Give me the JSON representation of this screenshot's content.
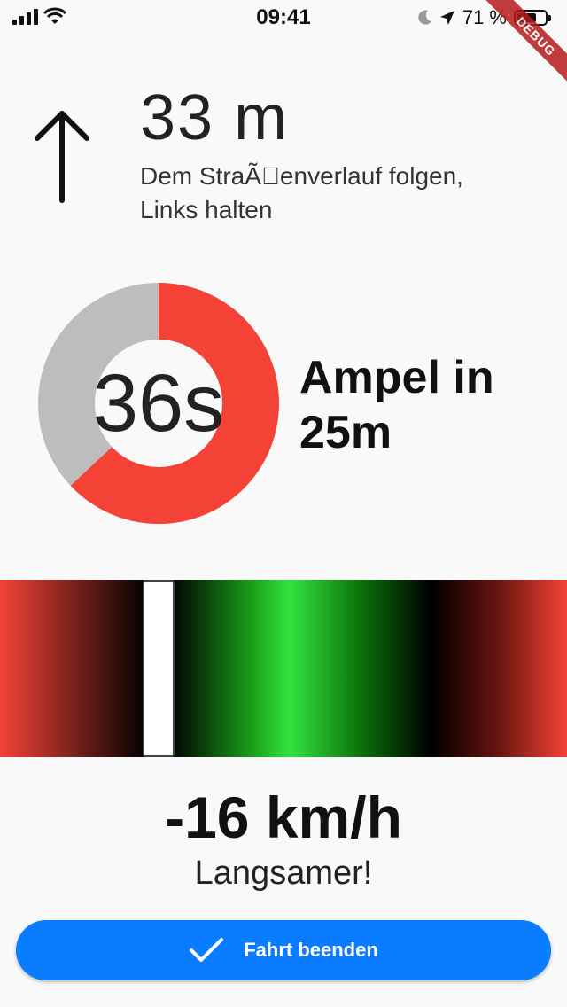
{
  "status_bar": {
    "time": "09:41",
    "battery_text": "71 %",
    "battery_level": 0.71,
    "icons": [
      "signal-icon",
      "wifi-icon",
      "moon-icon",
      "location-arrow-icon",
      "battery-icon"
    ]
  },
  "debug_banner": "DEBUG",
  "navigation": {
    "direction_icon": "arrow-up-icon",
    "distance": "33 m",
    "instruction": "Dem StraÃ\u0000enverlauf folgen, Links halten"
  },
  "traffic_light": {
    "countdown": "36s",
    "remaining_fraction": 0.63,
    "colors": {
      "remaining": "#f44336",
      "elapsed": "#bdbdbd"
    },
    "label": "Ampel in 25m"
  },
  "speed": {
    "marker_position": 0.28,
    "value": "-16 km/h",
    "hint": "Langsamer!"
  },
  "end_button": {
    "icon": "check-icon",
    "label": "Fahrt beenden",
    "color": "#0a7cff"
  }
}
